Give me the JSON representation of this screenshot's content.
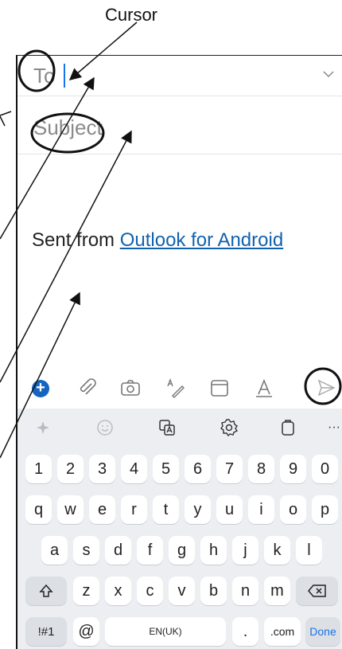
{
  "annotation": {
    "cursor_label": "Cursor"
  },
  "compose": {
    "to_label": "To",
    "subject_label": "Subject",
    "body_prefix": "Sent from ",
    "body_link": "Outlook for Android"
  },
  "compose_toolbar": {
    "icons": [
      "plus-icon",
      "attach-icon",
      "camera-icon",
      "draw-icon",
      "calendar-icon",
      "format-icon",
      "send-icon"
    ],
    "accent": "#1565c0"
  },
  "keyboard": {
    "toolbar_icons": [
      "ai-sparkle-icon",
      "emoji-icon",
      "translate-icon",
      "settings-icon",
      "clipboard-icon",
      "more-icon"
    ],
    "number_row": [
      "1",
      "2",
      "3",
      "4",
      "5",
      "6",
      "7",
      "8",
      "9",
      "0"
    ],
    "row1": [
      "q",
      "w",
      "e",
      "r",
      "t",
      "y",
      "u",
      "i",
      "o",
      "p"
    ],
    "row2": [
      "a",
      "s",
      "d",
      "f",
      "g",
      "h",
      "j",
      "k",
      "l"
    ],
    "row3": [
      "z",
      "x",
      "c",
      "v",
      "b",
      "n",
      "m"
    ],
    "symbols_key": "!#1",
    "at_key": "@",
    "space_label": "EN(UK)",
    "period_key": ".",
    "dotcom_key": ".com",
    "done_key": "Done"
  }
}
